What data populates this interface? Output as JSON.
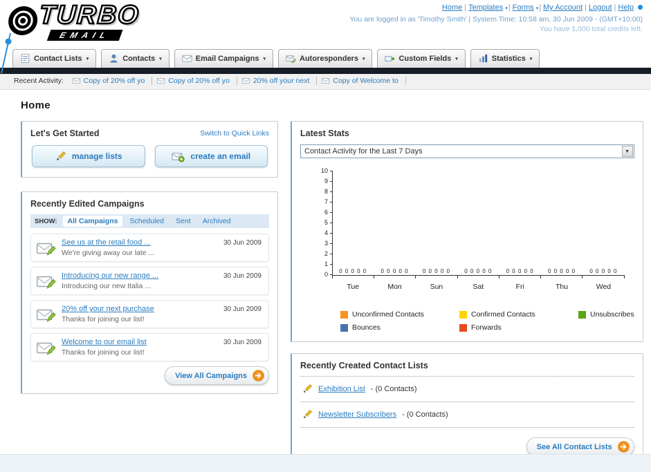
{
  "colors": {
    "link": "#2b7cbe",
    "nav_bar": "#161d27",
    "accent_orange": "#f7941d"
  },
  "logo": {
    "title": "TURBO",
    "subtitle": "EMAIL"
  },
  "top_nav": {
    "links": [
      {
        "label": "Home",
        "has_dropdown": false
      },
      {
        "label": "Templates",
        "has_dropdown": true
      },
      {
        "label": "Forms",
        "has_dropdown": true
      },
      {
        "label": "My Account",
        "has_dropdown": false
      },
      {
        "label": "Logout",
        "has_dropdown": false
      },
      {
        "label": "Help",
        "has_dropdown": false
      }
    ],
    "login_info": "You are logged in as 'Timothy Smith' | System Time: 10:58 am, 30 Jun 2009 - (GMT+10:00)",
    "credits_info": "You have 1,000 total credits left."
  },
  "main_nav": {
    "tabs": [
      {
        "label": "Contact Lists",
        "icon": "contact-lists-icon"
      },
      {
        "label": "Contacts",
        "icon": "contacts-icon"
      },
      {
        "label": "Email Campaigns",
        "icon": "email-campaigns-icon"
      },
      {
        "label": "Autoresponders",
        "icon": "autoresponders-icon"
      },
      {
        "label": "Custom Fields",
        "icon": "custom-fields-icon"
      },
      {
        "label": "Statistics",
        "icon": "statistics-icon"
      }
    ]
  },
  "recent_activity": {
    "label": "Recent Activity:",
    "items": [
      "Copy of 20% off yo",
      "Copy of 20% off yo",
      "20% off your next",
      "Copy of Welcome to"
    ]
  },
  "page_title": "Home",
  "get_started": {
    "title": "Let's Get Started",
    "switch_link": "Switch to Quick Links",
    "buttons": [
      {
        "label": "manage lists",
        "icon": "pencil-icon"
      },
      {
        "label": "create an email",
        "icon": "envelope-plus-icon"
      }
    ]
  },
  "campaigns": {
    "title": "Recently Edited Campaigns",
    "show_label": "SHOW:",
    "filters": [
      "All Campaigns",
      "Scheduled",
      "Sent",
      "Archived"
    ],
    "items": [
      {
        "title": "See us at the retail food ...",
        "subtitle": "We're giving away our late ...",
        "date": "30 Jun 2009"
      },
      {
        "title": "Introducing our new range ...",
        "subtitle": "Introducing our new Italia ...",
        "date": "30 Jun 2009"
      },
      {
        "title": "20% off your next purchase",
        "subtitle": "Thanks for joining our list!",
        "date": "30 Jun 2009"
      },
      {
        "title": "Welcome to our email list",
        "subtitle": "Thanks for joining our list!",
        "date": "30 Jun 2009"
      }
    ],
    "view_all_label": "View All Campaigns"
  },
  "latest_stats": {
    "title": "Latest Stats",
    "dropdown_value": "Contact Activity for the Last 7 Days"
  },
  "chart_data": {
    "type": "bar",
    "title": "Contact Activity for the Last 7 Days",
    "categories": [
      "Tue",
      "Mon",
      "Sun",
      "Sat",
      "Fri",
      "Thu",
      "Wed"
    ],
    "series": [
      {
        "name": "Unconfirmed Contacts",
        "color": "#f7941d",
        "values": [
          0,
          0,
          0,
          0,
          0,
          0,
          0
        ]
      },
      {
        "name": "Confirmed Contacts",
        "color": "#ffd400",
        "values": [
          0,
          0,
          0,
          0,
          0,
          0,
          0
        ]
      },
      {
        "name": "Unsubscribes",
        "color": "#5aa616",
        "values": [
          0,
          0,
          0,
          0,
          0,
          0,
          0
        ]
      },
      {
        "name": "Bounces",
        "color": "#4c6fae",
        "values": [
          0,
          0,
          0,
          0,
          0,
          0,
          0
        ]
      },
      {
        "name": "Forwards",
        "color": "#e8491f",
        "values": [
          0,
          0,
          0,
          0,
          0,
          0,
          0
        ]
      }
    ],
    "xlabel": "",
    "ylabel": "",
    "ylim": [
      0,
      10
    ],
    "yticks": [
      0,
      1,
      2,
      3,
      4,
      5,
      6,
      7,
      8,
      9,
      10
    ],
    "grid": false,
    "legend_position": "bottom"
  },
  "contact_lists": {
    "title": "Recently Created Contact Lists",
    "items": [
      {
        "name": "Exhibition List",
        "suffix": "- (0 Contacts)"
      },
      {
        "name": "Newsletter Subscribers",
        "suffix": "- (0 Contacts)"
      }
    ],
    "see_all_label": "See All Contact Lists"
  }
}
